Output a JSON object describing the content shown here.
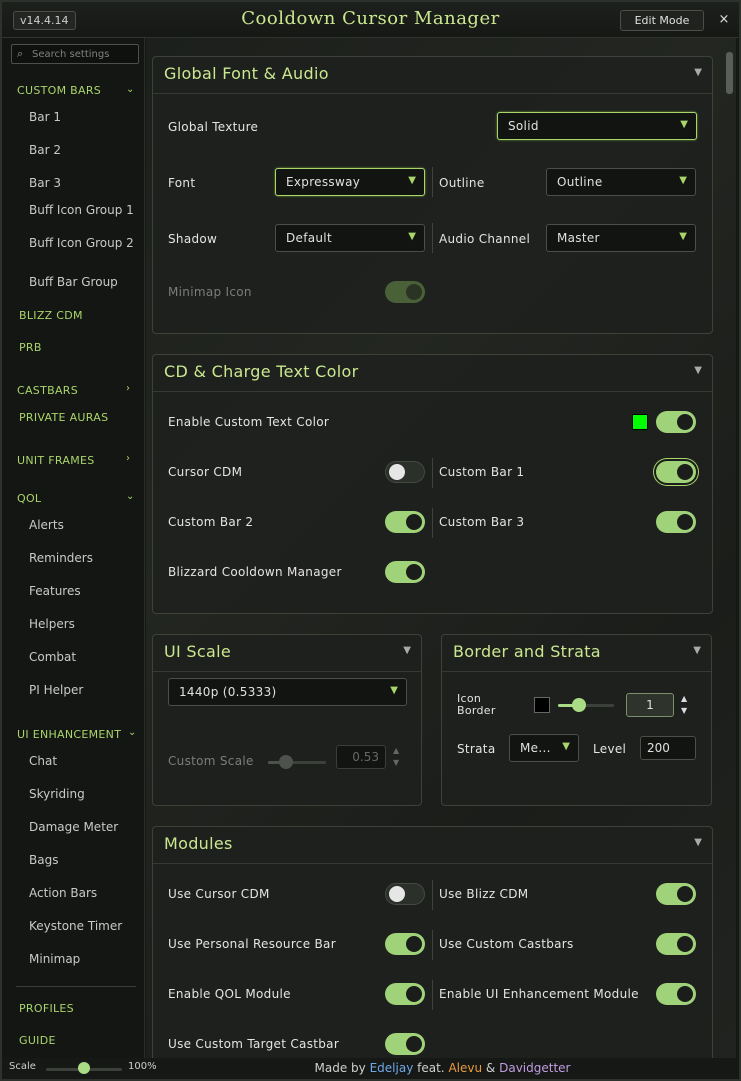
{
  "header": {
    "version": "v14.4.14",
    "title": "Cooldown Cursor Manager",
    "edit_mode_label": "Edit Mode",
    "close_glyph": "×"
  },
  "sidebar": {
    "search_placeholder": "Search settings",
    "sections": [
      {
        "label": "CUSTOM BARS",
        "expanded": true,
        "items": [
          "Bar 1",
          "Bar 2",
          "Bar 3",
          "Buff Icon Group 1",
          "Buff Icon Group 2",
          "Buff Bar Group"
        ]
      },
      {
        "label": "BLIZZ CDM"
      },
      {
        "label": "PRB"
      },
      {
        "label": "CASTBARS",
        "expanded": false
      },
      {
        "label": "PRIVATE AURAS"
      },
      {
        "label": "UNIT FRAMES",
        "expanded": false
      },
      {
        "label": "QOL",
        "expanded": true,
        "items": [
          "Alerts",
          "Reminders",
          "Features",
          "Helpers",
          "Combat",
          "PI Helper"
        ]
      },
      {
        "label": "UI ENHANCEMENT",
        "expanded": true,
        "items": [
          "Chat",
          "Skyriding",
          "Damage Meter",
          "Bags",
          "Action Bars",
          "Keystone Timer",
          "Minimap"
        ]
      },
      {
        "label": "PROFILES"
      },
      {
        "label": "GUIDE"
      }
    ],
    "scale": {
      "label": "Scale",
      "value_text": "100%",
      "value": 1.0
    }
  },
  "sections": {
    "font_audio": {
      "title": "Global Font & Audio",
      "global_texture": {
        "label": "Global Texture",
        "value": "Solid"
      },
      "font": {
        "label": "Font",
        "value": "Expressway"
      },
      "outline": {
        "label": "Outline",
        "value": "Outline"
      },
      "shadow": {
        "label": "Shadow",
        "value": "Default"
      },
      "audio_channel": {
        "label": "Audio Channel",
        "value": "Master"
      },
      "minimap_icon": {
        "label": "Minimap Icon",
        "enabled": true,
        "disabled": true
      }
    },
    "cd_text_color": {
      "title": "CD & Charge Text Color",
      "enable_custom": {
        "label": "Enable Custom Text Color",
        "enabled": true,
        "swatch_color": "#00ff00"
      },
      "cursor_cdm": {
        "label": "Cursor CDM",
        "enabled": false
      },
      "custom_bar_1": {
        "label": "Custom Bar 1",
        "enabled": true
      },
      "custom_bar_2": {
        "label": "Custom Bar 2",
        "enabled": true
      },
      "custom_bar_3": {
        "label": "Custom Bar 3",
        "enabled": true
      },
      "blizzard_cdm": {
        "label": "Blizzard Cooldown Manager",
        "enabled": true
      }
    },
    "ui_scale": {
      "title": "UI Scale",
      "preset": "1440p (0.5333)",
      "custom_scale": {
        "label": "Custom Scale",
        "value": "0.53",
        "disabled": true
      }
    },
    "border_strata": {
      "title": "Border and Strata",
      "icon_border": {
        "label_line1": "Icon",
        "label_line2": "Border",
        "color": "#000000",
        "value": "1"
      },
      "strata": {
        "label": "Strata",
        "value": "Me..."
      },
      "level": {
        "label": "Level",
        "value": "200"
      }
    },
    "modules": {
      "title": "Modules",
      "use_cursor_cdm": {
        "label": "Use Cursor CDM",
        "enabled": false
      },
      "use_blizz_cdm": {
        "label": "Use Blizz CDM",
        "enabled": true
      },
      "use_prb": {
        "label": "Use Personal Resource Bar",
        "enabled": true
      },
      "use_custom_castbars": {
        "label": "Use Custom Castbars",
        "enabled": true
      },
      "enable_qol": {
        "label": "Enable QOL Module",
        "enabled": true
      },
      "enable_ui_enh": {
        "label": "Enable UI Enhancement Module",
        "enabled": true
      },
      "use_target_castbar": {
        "label": "Use Custom Target Castbar",
        "enabled": true
      }
    }
  },
  "footer": {
    "made_by": "Made by",
    "author1": "Edeljay",
    "feat": "feat.",
    "author2": "Alevu",
    "amp": "&",
    "author3": "Davidgetter"
  },
  "colors": {
    "accent": "#a9d56a",
    "title": "#c9e88f",
    "toggle_on": "#a0d27a"
  }
}
